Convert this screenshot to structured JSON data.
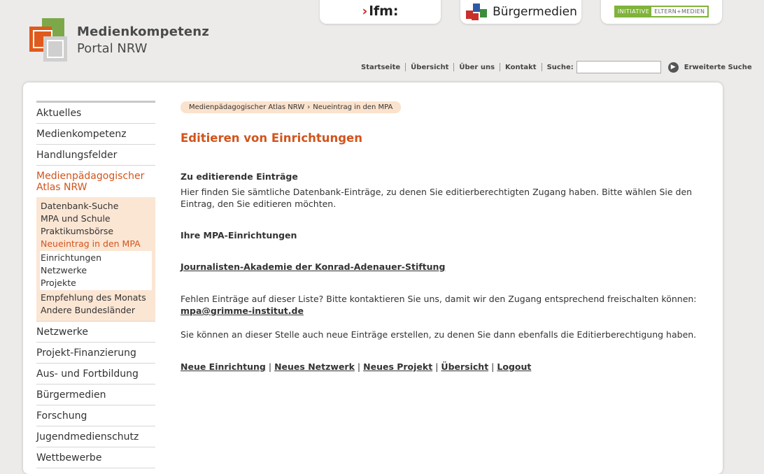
{
  "header": {
    "logo_line1": "Medienkompetenz",
    "logo_line2": "Portal NRW",
    "partners": {
      "lfm": "lfm:",
      "buergermedien": "Bürgermedien",
      "initiative_a": "INITIATIVE",
      "initiative_b": "ELTERN+MEDIEN"
    },
    "nav": [
      "Startseite",
      "Übersicht",
      "Über uns",
      "Kontakt"
    ],
    "search_label": "Suche:",
    "search_value": "",
    "advanced_search": "Erweiterte Suche"
  },
  "sidebar": {
    "items_top": [
      "Aktuelles",
      "Medienkompetenz",
      "Handlungsfelder"
    ],
    "active_item": "Medienpädagogischer Atlas NRW",
    "sub_items": [
      "Datenbank-Suche",
      "MPA und Schule",
      "Praktikumsbörse"
    ],
    "active_sub": "Neueintrag in den MPA",
    "subsub_items": [
      "Einrichtungen",
      "Netzwerke",
      "Projekte"
    ],
    "sub_items_after": [
      "Empfehlung des Monats",
      "Andere Bundesländer"
    ],
    "items_bottom": [
      "Netzwerke",
      "Projekt-Finanzierung",
      "Aus- und Fortbildung",
      "Bürgermedien",
      "Forschung",
      "Jugendmedienschutz",
      "Wettbewerbe"
    ]
  },
  "content": {
    "breadcrumb": [
      "Medienpädagogischer Atlas NRW",
      "Neueintrag in den MPA"
    ],
    "title": "Editieren von Einrichtungen",
    "section1_heading": "Zu editierende Einträge",
    "section1_text": "Hier finden Sie sämtliche Datenbank-Einträge, zu denen Sie editierberechtigten Zugang haben. Bitte wählen Sie den Eintrag, den Sie editieren möchten.",
    "section2_heading": "Ihre MPA-Einrichtungen",
    "entry_link": "Journalisten-Akademie der Konrad-Adenauer-Stiftung",
    "missing_text": "Fehlen Einträge auf dieser Liste? Bitte kontaktieren Sie uns, damit wir den Zugang entsprechend freischalten können:",
    "email": "mpa@grimme-institut.de",
    "create_text": "Sie können an dieser Stelle auch neue Einträge erstellen, zu denen Sie dann ebenfalls die Editierberechtigung haben.",
    "actions": [
      "Neue Einrichtung",
      "Neues Netzwerk",
      "Neues Projekt",
      "Übersicht",
      "Logout"
    ]
  },
  "colors": {
    "accent": "#d2541c",
    "submenu_bg": "#fbe6d4",
    "breadcrumb_bg": "#fbe2cc",
    "page_bg": "#ecebea"
  }
}
